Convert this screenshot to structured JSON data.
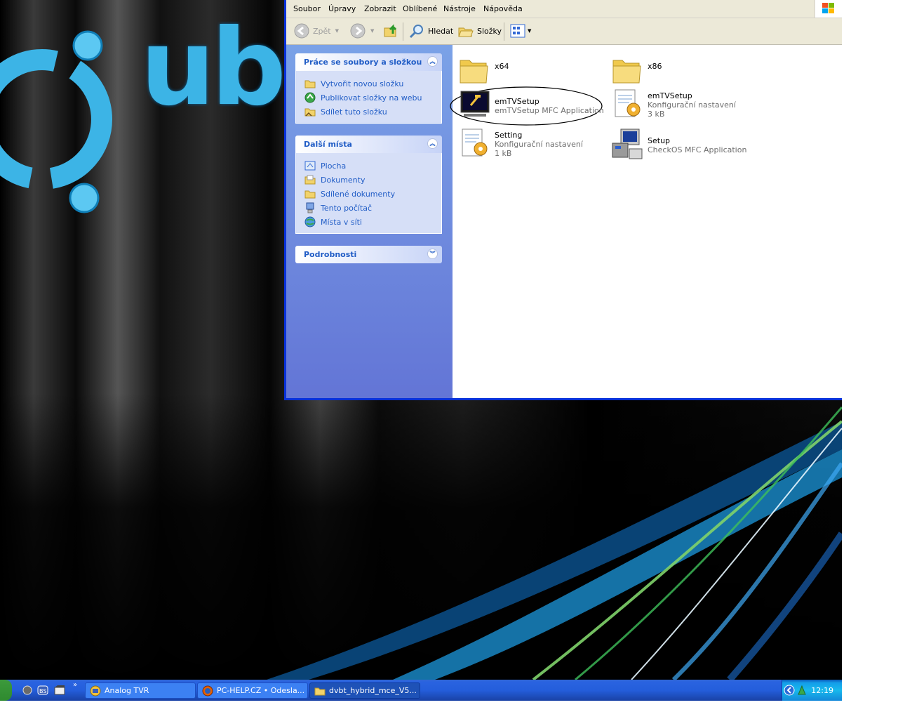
{
  "menubar": {
    "items": [
      "Soubor",
      "Úpravy",
      "Zobrazit",
      "Oblíbené",
      "Nástroje",
      "Nápověda"
    ]
  },
  "toolbar": {
    "back_label": "Zpět",
    "search_label": "Hledat",
    "folders_label": "Složky"
  },
  "taskpane": {
    "file_tasks": {
      "title": "Práce se soubory a složkou",
      "items": [
        "Vytvořit novou složku",
        "Publikovat složky na webu",
        "Sdílet tuto složku"
      ]
    },
    "other_places": {
      "title": "Další místa",
      "items": [
        "Plocha",
        "Dokumenty",
        "Sdílené dokumenty",
        "Tento počítač",
        "Místa v síti"
      ]
    },
    "details": {
      "title": "Podrobnosti"
    }
  },
  "files": [
    {
      "name": "x64",
      "icon": "folder-icon"
    },
    {
      "name": "x86",
      "icon": "folder-icon"
    },
    {
      "name": "emTVSetup",
      "desc": "emTVSetup MFC Application",
      "icon": "application-icon"
    },
    {
      "name": "emTVSetup",
      "desc": "Konfigurační nastavení",
      "size": "3 kB",
      "icon": "config-file-icon"
    },
    {
      "name": "Setting",
      "desc": "Konfigurační nastavení",
      "size": "1 kB",
      "icon": "config-file-icon"
    },
    {
      "name": "Setup",
      "desc": "CheckOS MFC Application",
      "icon": "setup-icon"
    }
  ],
  "taskbar": {
    "tasks": [
      "Analog TVR",
      "PC-HELP.CZ • Odesla...",
      "dvbt_hybrid_mce_V5..."
    ],
    "clock": "12:19"
  },
  "desktop": {
    "logo_text": "ub"
  },
  "colors": {
    "xp_blue": "#0831d9",
    "taskpane_link": "#215dc6",
    "taskbar": "#245edb",
    "logo_cyan": "#3cb4e6"
  }
}
